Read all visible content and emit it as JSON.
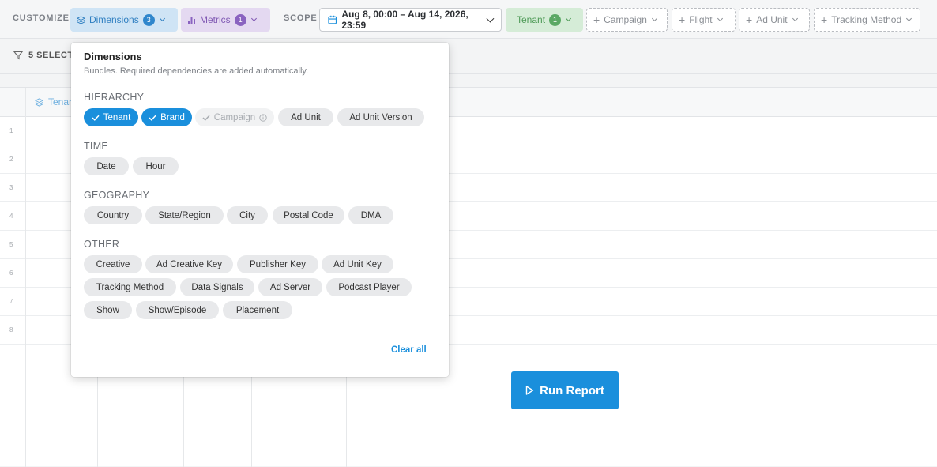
{
  "toolbar": {
    "customize_label": "CUSTOMIZE",
    "dimensions": {
      "label": "Dimensions",
      "count": "3"
    },
    "metrics": {
      "label": "Metrics",
      "count": "1"
    },
    "scope_label": "SCOPE",
    "date_range": "Aug 8, 00:00 – Aug 14, 2026, 23:59",
    "tenant": {
      "label": "Tenant",
      "count": "1"
    },
    "filters": [
      "Campaign",
      "Flight",
      "Ad Unit",
      "Tracking Method"
    ]
  },
  "subbar": {
    "selected_text": "5 SELECTE"
  },
  "grid": {
    "header_first": "Tenan",
    "row_numbers": [
      "1",
      "2",
      "3",
      "4",
      "5",
      "6",
      "7",
      "8"
    ]
  },
  "run_button": "Run Report",
  "panel": {
    "title": "Dimensions",
    "subtitle": "Bundles. Required dependencies are added automatically.",
    "sections": {
      "hierarchy": {
        "title": "HIERARCHY",
        "chips": [
          "Tenant",
          "Brand",
          "Campaign",
          "Ad Unit",
          "Ad Unit Version"
        ]
      },
      "time": {
        "title": "TIME",
        "chips": [
          "Date",
          "Hour"
        ]
      },
      "geography": {
        "title": "GEOGRAPHY",
        "chips": [
          "Country",
          "State/Region",
          "City",
          "Postal Code",
          "DMA"
        ]
      },
      "other": {
        "title": "OTHER",
        "chips": [
          "Creative",
          "Ad Creative Key",
          "Publisher Key",
          "Ad Unit Key",
          "Tracking Method",
          "Data Signals",
          "Ad Server",
          "Podcast Player",
          "Show",
          "Show/Episode",
          "Placement"
        ]
      }
    },
    "clear_all": "Clear all"
  },
  "colors": {
    "accent": "#1a8fdc",
    "dimensions": "#2f7fc1",
    "metrics": "#7f58b3",
    "tenant": "#4e9a57"
  }
}
